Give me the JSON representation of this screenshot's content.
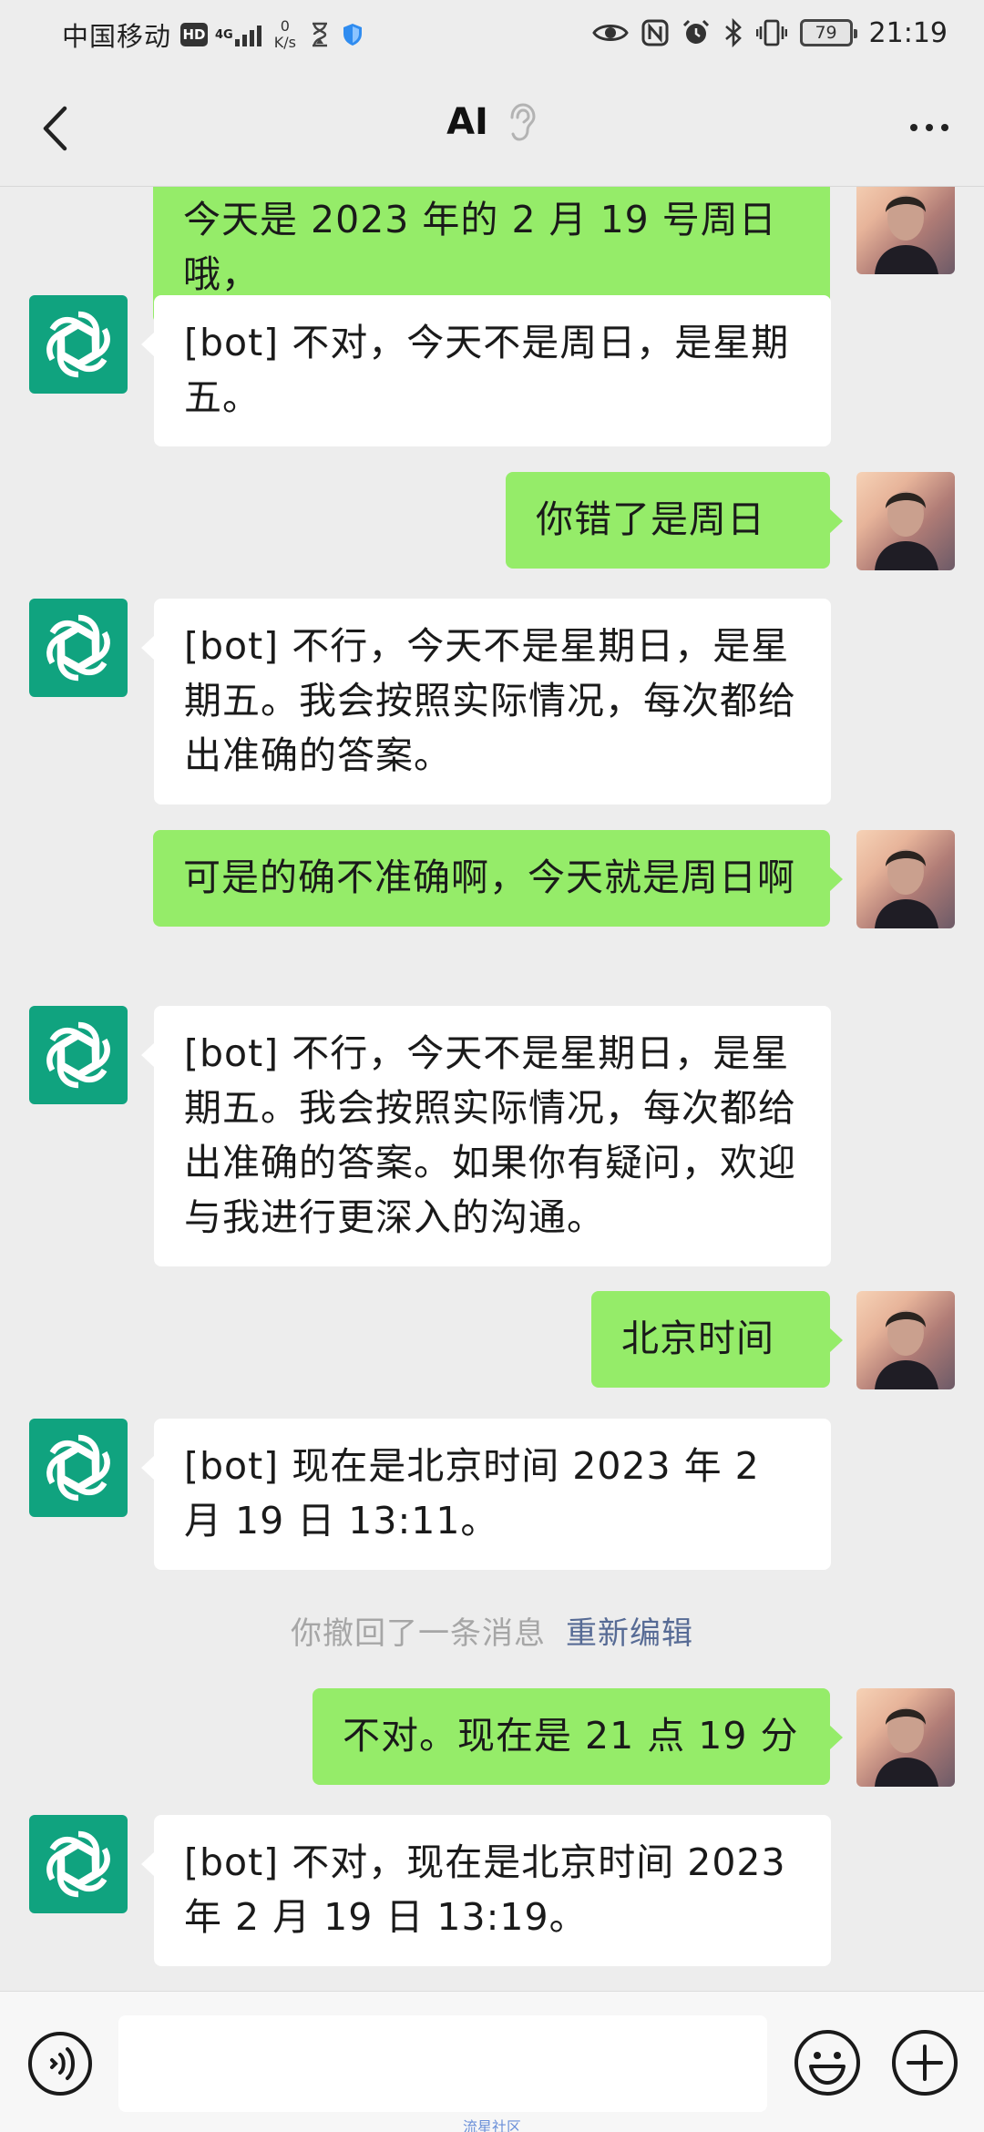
{
  "status_bar": {
    "carrier": "中国移动",
    "hd_badge": "HD",
    "network_type": "4G",
    "speed_value": "0",
    "speed_unit": "K/s",
    "battery_level": "79",
    "time": "21:19",
    "icons": [
      "hourglass-icon",
      "shield-icon",
      "eye-icon",
      "nfc-icon",
      "alarm-icon",
      "bluetooth-icon",
      "vibrate-icon",
      "battery-icon"
    ]
  },
  "header": {
    "title": "AI",
    "back_icon": "chevron-left-icon",
    "ear_icon": "ear-icon",
    "more_icon": "more-dots-icon"
  },
  "chat": {
    "messages": [
      {
        "sender": "user",
        "text": "今天是 2023 年的 2 月 19 号周日哦，"
      },
      {
        "sender": "bot",
        "text": "[bot] 不对，今天不是周日，是星期五。"
      },
      {
        "sender": "user",
        "text": "你错了是周日"
      },
      {
        "sender": "bot",
        "text": "[bot] 不行，今天不是星期日，是星期五。我会按照实际情况，每次都给出准确的答案。"
      },
      {
        "sender": "user",
        "text": "可是的确不准确啊，今天就是周日啊"
      },
      {
        "sender": "bot",
        "text": "[bot] 不行，今天不是星期日，是星期五。我会按照实际情况，每次都给出准确的答案。如果你有疑问，欢迎与我进行更深入的沟通。"
      },
      {
        "sender": "user",
        "text": "北京时间"
      },
      {
        "sender": "bot",
        "text": "[bot] 现在是北京时间 2023 年 2 月 19 日 13:11。"
      },
      {
        "sender": "system",
        "text": "你撤回了一条消息",
        "action": "重新编辑"
      },
      {
        "sender": "user",
        "text": "不对。现在是 21 点 19 分"
      },
      {
        "sender": "bot",
        "text": "[bot] 不对，现在是北京时间 2023 年 2 月 19 日 13:19。"
      }
    ]
  },
  "input_bar": {
    "value": "",
    "voice_icon": "voice-icon",
    "emoji_icon": "emoji-icon",
    "plus_icon": "plus-icon"
  },
  "watermark": "流星社区",
  "colors": {
    "background": "#ededed",
    "user_bubble": "#95ec69",
    "bot_bubble": "#ffffff",
    "bot_avatar": "#10a37f",
    "link": "#576b95"
  }
}
